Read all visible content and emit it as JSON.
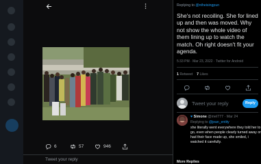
{
  "viewer": {
    "back_icon": "arrow-left-icon",
    "more_icon": "more-icon",
    "actions": [
      {
        "name": "reply",
        "icon": "reply-icon",
        "count": "6"
      },
      {
        "name": "retweet",
        "icon": "retweet-icon",
        "count": "57"
      },
      {
        "name": "like",
        "icon": "heart-icon",
        "count": "946"
      },
      {
        "name": "share",
        "icon": "share-icon",
        "count": ""
      }
    ],
    "reply_placeholder": "Tweet your reply"
  },
  "tweet": {
    "replying_prefix": "Replying to",
    "replying_to": "@ntheisingpun",
    "text": "She's not recoiling. She for lined up and then was moved. Why not show the whole video of them lining up to watch the match. Oh right doesn't fit your agenda.",
    "meta": "5:33 PM · Mar 23, 2022 · Twitter for Android",
    "retweets_count": "1",
    "retweets_label": "Retweet",
    "likes_count": "7",
    "likes_label": "Likes"
  },
  "composer": {
    "placeholder": "Tweet your reply",
    "button_label": "Reply"
  },
  "reply": {
    "name": "Simone",
    "handle": "@mel777",
    "date": "· Mar 24",
    "replying_prefix": "Replying to",
    "replying_to": "@jean_entity",
    "text": "she literally went everywhere they told her to go, even when people clearly turned away or had their face made up, she smiled, i watched it carefully."
  },
  "next_reply_name": "More Replies",
  "colors": {
    "accent": "#1d9bf0",
    "background": "#000000",
    "text": "#e7e9ea",
    "muted": "#71767b"
  }
}
